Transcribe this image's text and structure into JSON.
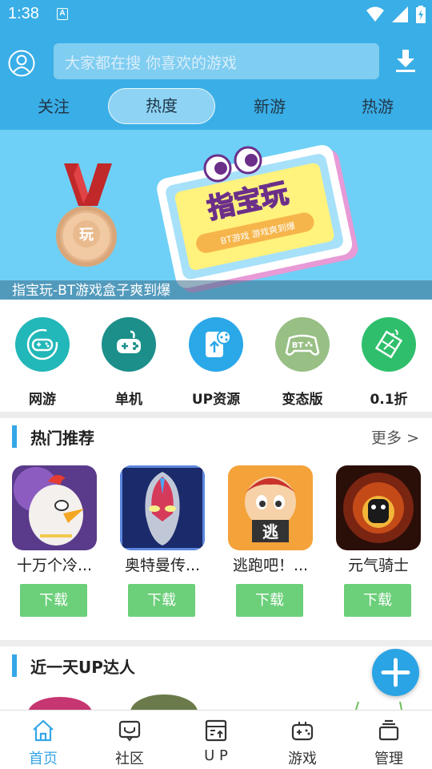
{
  "status_bar": {
    "time": "1:38",
    "a_glyph": "A"
  },
  "header": {
    "search_placeholder": "大家都在搜  你喜欢的游戏",
    "tabs": [
      {
        "label": "关注",
        "active": false
      },
      {
        "label": "热度",
        "active": true
      },
      {
        "label": "新游",
        "active": false
      },
      {
        "label": "热游",
        "active": false
      }
    ]
  },
  "banner": {
    "caption": "指宝玩-BT游戏盒子爽到爆",
    "logo_text": "指宝玩",
    "logo_subtext": "BT游戏 游戏爽到爆",
    "medal_text": "玩"
  },
  "categories": [
    {
      "label": "网游",
      "icon": "gamepad-icon",
      "color": "#22b7b8"
    },
    {
      "label": "单机",
      "icon": "joystick-icon",
      "color": "#1c8f8a"
    },
    {
      "label": "UP资源",
      "icon": "upload-share-icon",
      "color": "#2aa8e8"
    },
    {
      "label": "变态版",
      "icon": "bt-controller-icon",
      "color": "#98bf84"
    },
    {
      "label": "0.1折",
      "icon": "discount-tag-icon",
      "color": "#2fbf6c"
    }
  ],
  "hot_section": {
    "title": "热门推荐",
    "more": "更多 >",
    "games": [
      {
        "name": "十万个冷...",
        "button": "下载"
      },
      {
        "name": "奥特曼传...",
        "button": "下载"
      },
      {
        "name": "逃跑吧！...",
        "button": "下载"
      },
      {
        "name": "元气骑士",
        "button": "下载"
      }
    ],
    "thumb3_text": "逃"
  },
  "up_section": {
    "title": "近一天UP达人"
  },
  "bottom_nav": [
    {
      "label": "首页",
      "icon": "home-icon",
      "active": true
    },
    {
      "label": "社区",
      "icon": "community-icon",
      "active": false
    },
    {
      "label": "U P",
      "icon": "up-icon",
      "active": false
    },
    {
      "label": "游戏",
      "icon": "game-controller-icon",
      "active": false
    },
    {
      "label": "管理",
      "icon": "manage-icon",
      "active": false
    }
  ],
  "colors": {
    "primary": "#3aaee6",
    "download_green": "#6ccf7a",
    "accent_blue": "#35a7e6"
  }
}
